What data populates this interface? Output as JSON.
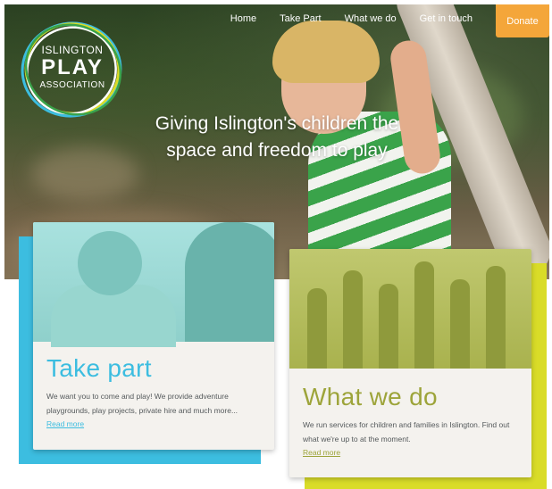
{
  "logo": {
    "line1": "ISLINGTON",
    "line2": "PLAY",
    "line3": "ASSOCIATION",
    "ring_colors": [
      "#3cbde0",
      "#d9dc28",
      "#ffffff",
      "#3aa34a"
    ]
  },
  "nav": {
    "items": [
      "Home",
      "Take Part",
      "What we do",
      "Get in touch"
    ],
    "donate_label": "Donate"
  },
  "hero": {
    "tagline_line1": "Giving Islington's children the",
    "tagline_line2": "space and freedom to play"
  },
  "cards": [
    {
      "title": "Take part",
      "text": "We want you to come and play! We provide adventure playgrounds, play projects, private hire and much more...",
      "link": "Read more",
      "accent_color": "#3cbde0"
    },
    {
      "title": "What we do",
      "text": "We run services for children and families in Islington. Find out what we're up to at the moment.",
      "link": "Read more",
      "accent_color": "#d9dc28"
    }
  ],
  "colors": {
    "donate": "#f4a63a",
    "card_bg": "#f4f2ee",
    "text": "#555a5c"
  }
}
